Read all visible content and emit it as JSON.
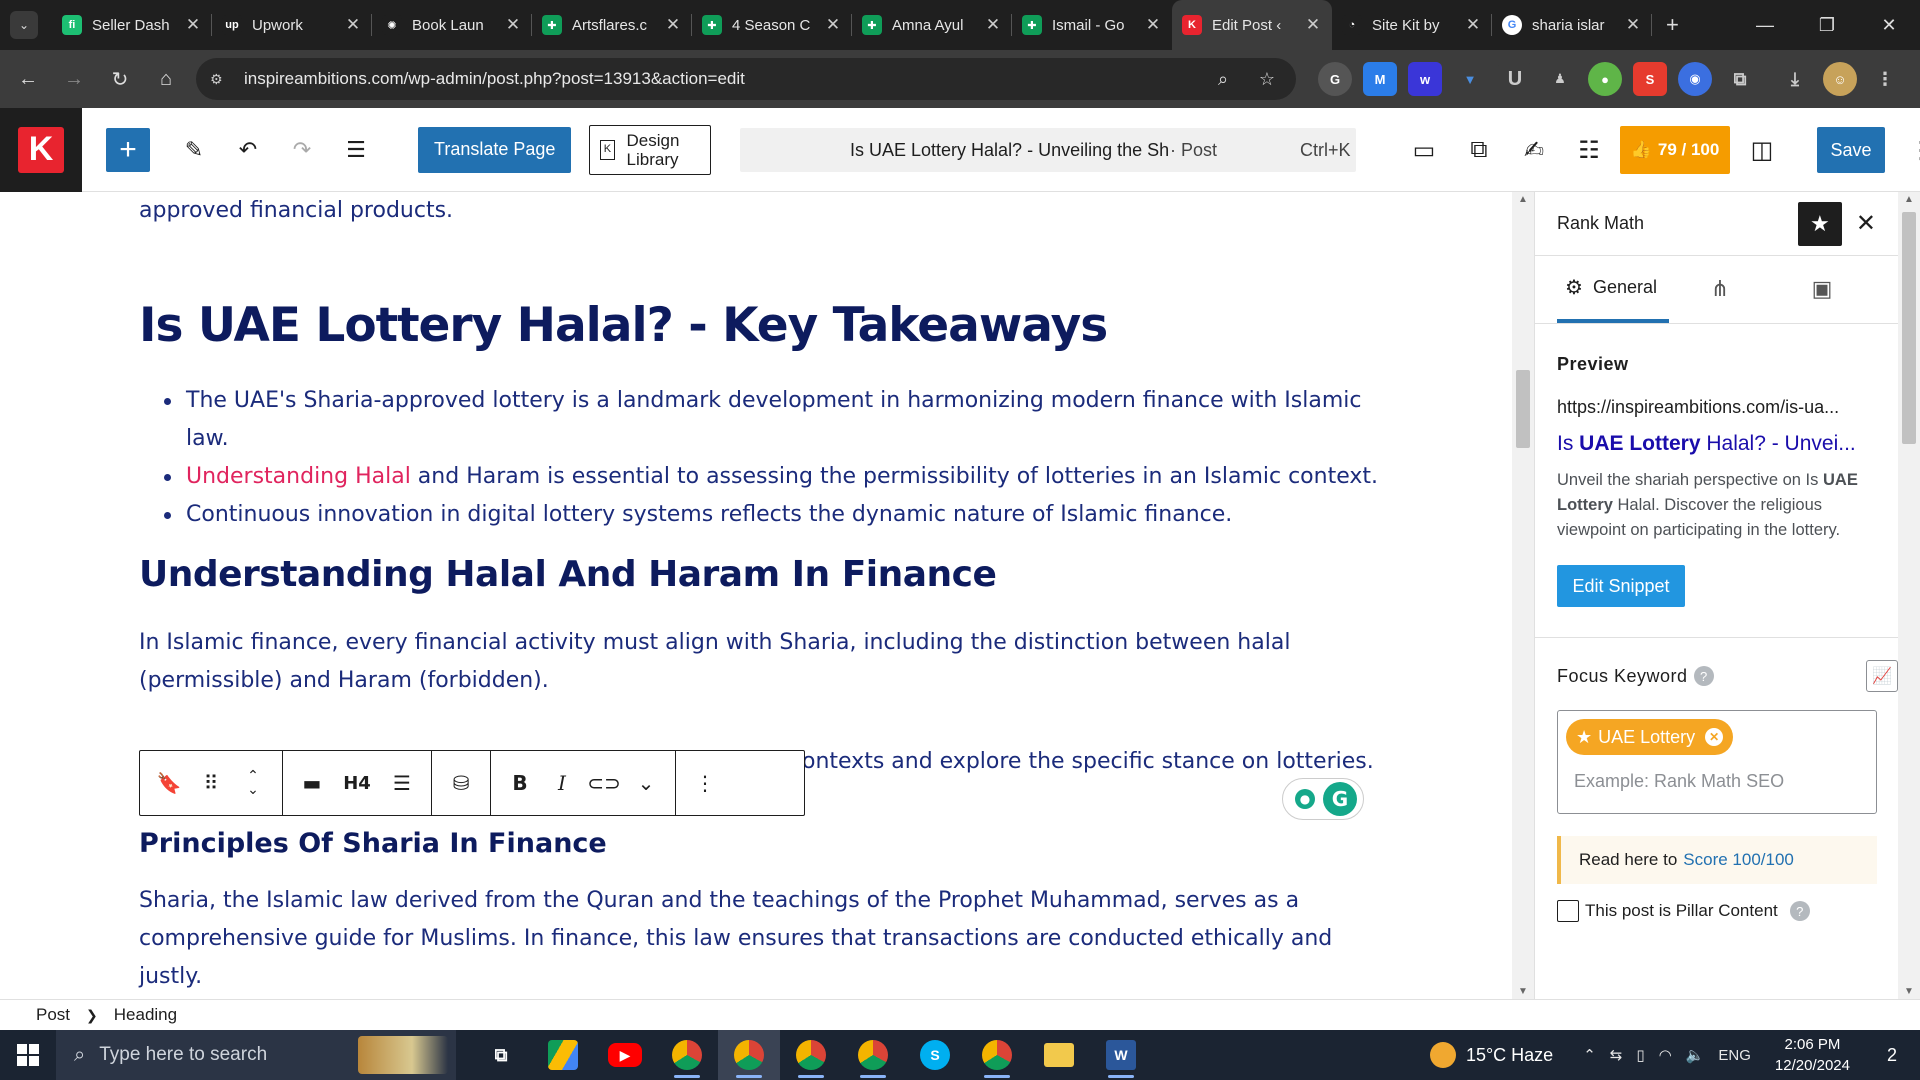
{
  "browser": {
    "tabs": [
      {
        "label": "Seller Dash",
        "favicon": "fiverr-icon",
        "color": "#1dbf73",
        "glyph": "fi"
      },
      {
        "label": "Upwork",
        "favicon": "upwork-icon",
        "color": "#1f1f1f",
        "glyph": "up"
      },
      {
        "label": "Book Laun",
        "favicon": "openai-icon",
        "color": "#1f1f1f",
        "glyph": "✺"
      },
      {
        "label": "Artsflares.c",
        "favicon": "sheets-icon",
        "color": "#0f9d58",
        "glyph": "✚"
      },
      {
        "label": "4 Season C",
        "favicon": "sheets-icon",
        "color": "#0f9d58",
        "glyph": "✚"
      },
      {
        "label": "Amna Ayul",
        "favicon": "sheets-icon",
        "color": "#0f9d58",
        "glyph": "✚"
      },
      {
        "label": "Ismail - Go",
        "favicon": "sheets-icon",
        "color": "#0f9d58",
        "glyph": "✚"
      },
      {
        "label": "Edit Post ‹",
        "favicon": "kadence-icon",
        "color": "#e8242f",
        "glyph": "K"
      },
      {
        "label": "Site Kit by",
        "favicon": "sitekit-icon",
        "color": "#1f1f1f",
        "glyph": "◔"
      },
      {
        "label": "sharia islar",
        "favicon": "google-icon",
        "color": "#ffffff",
        "glyph": "G"
      }
    ],
    "url": "inspireambitions.com/wp-admin/post.php?post=13913&action=edit"
  },
  "editor": {
    "translate_label": "Translate Page",
    "design_library_label": "Design Library",
    "command_title": "Is UAE Lottery Halal? - Unveiling the Sh...",
    "command_type": "· Post",
    "command_shortcut": "Ctrl+K",
    "score_label": "79 / 100",
    "save_label": "Save"
  },
  "content": {
    "intro_tail": "approved financial products.",
    "h2_takeaways": "Is UAE Lottery Halal? - Key Takeaways",
    "bullet_1": "The UAE's Sharia-approved lottery is a landmark development in harmonizing modern finance with Islamic law.",
    "bullet_2_link": "Understanding Halal",
    "bullet_2_rest": " and Haram is essential to assessing the permissibility of lotteries in an Islamic context.",
    "bullet_3": "Continuous innovation in digital lottery systems reflects the dynamic nature of Islamic finance.",
    "h3_understanding": "Understanding Halal And Haram In Finance",
    "para_1": "In Islamic finance, every financial activity must align with Sharia, including the distinction between halal (permissible) and Haram (forbidden).",
    "para_2_visible": "ontexts and explore the specific stance on lotteries.",
    "h4_principles": "Principles Of Sharia In Finance",
    "para_3": "Sharia, the Islamic law derived from the Quran and the teachings of the Prophet Muhammad, serves as a comprehensive guide for Muslims. In finance, this law ensures that transactions are conducted ethically and justly.",
    "toolbar_heading_level": "H4"
  },
  "rankmath": {
    "title": "Rank Math",
    "tab_general": "General",
    "preview_heading": "Preview",
    "preview_url": "https://inspireambitions.com/is-ua...",
    "preview_title_pre": "Is ",
    "preview_title_bold": "UAE Lottery",
    "preview_title_post": " Halal? - Unvei...",
    "preview_desc_pre": "Unveil the shariah perspective on Is ",
    "preview_desc_bold": "UAE Lottery",
    "preview_desc_post": " Halal. Discover the religious viewpoint on participating in the lottery.",
    "edit_snippet_label": "Edit Snippet",
    "focus_keyword_label": "Focus Keyword",
    "keyword_chip": "UAE Lottery",
    "keyword_placeholder": "Example: Rank Math SEO",
    "read_here_pre": "Read here to",
    "read_here_link": "Score 100/100",
    "pillar_label": "This post is Pillar Content"
  },
  "footer": {
    "crumb_post": "Post",
    "crumb_heading": "Heading"
  },
  "taskbar": {
    "search_placeholder": "Type here to search",
    "weather": "15°C  Haze",
    "language": "ENG",
    "time": "2:06 PM",
    "date": "12/20/2024",
    "notifications": "2"
  }
}
